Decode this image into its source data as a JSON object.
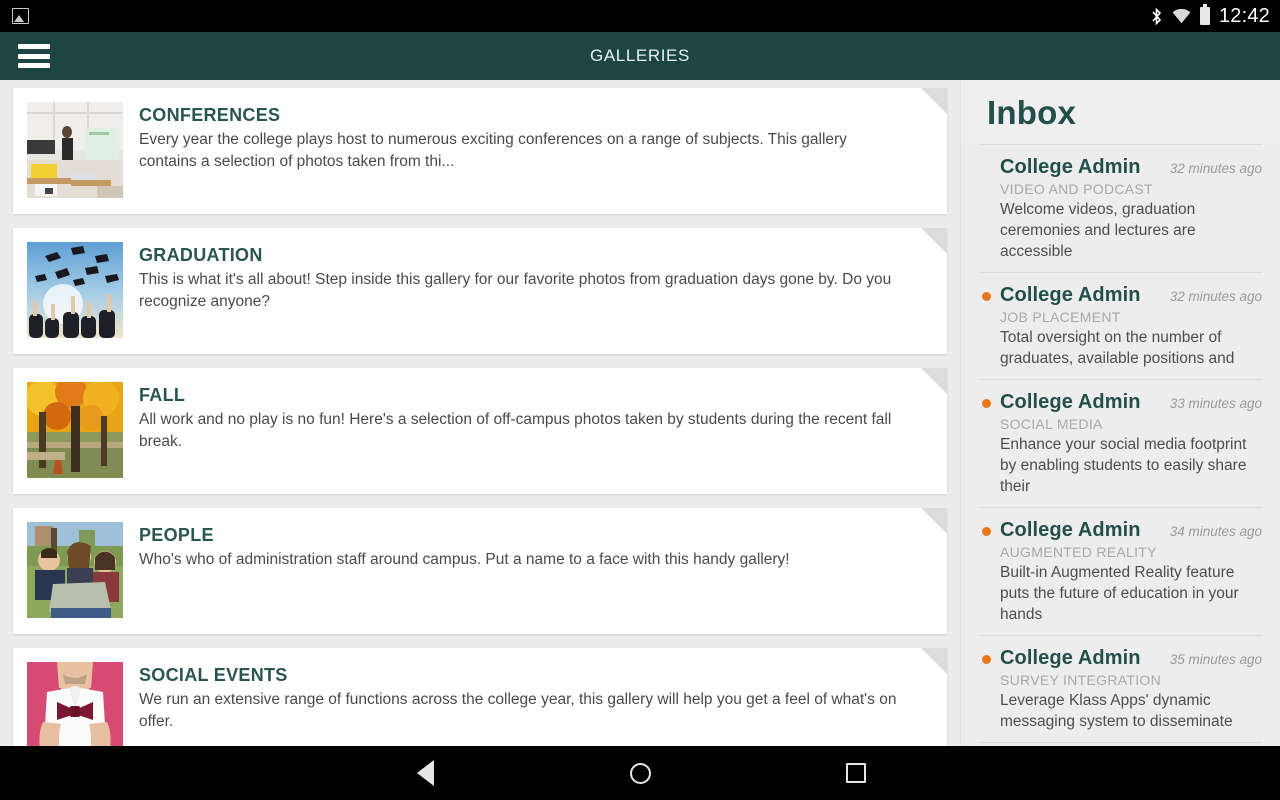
{
  "status_bar": {
    "notification_icon": "photo-icon",
    "icons": [
      "bluetooth-icon",
      "wifi-icon",
      "battery-icon"
    ],
    "time": "12:42"
  },
  "app_bar": {
    "menu_icon": "hamburger-menu-icon",
    "title": "GALLERIES"
  },
  "galleries": [
    {
      "title": "CONFERENCES",
      "description": "Every year the college plays host to numerous exciting conferences on a range of subjects.  This gallery contains a selection of photos taken from thi...",
      "thumb": "conference-lecture-hall-photo"
    },
    {
      "title": "GRADUATION",
      "description": "This is what it's all about!  Step inside this gallery for our favorite photos from graduation days gone by.  Do you recognize anyone?",
      "thumb": "graduation-caps-thrown-photo"
    },
    {
      "title": "FALL",
      "description": "All work and no play is no fun!  Here's a selection of off-campus photos taken by students during the recent fall break.",
      "thumb": "autumn-trees-park-photo"
    },
    {
      "title": "PEOPLE",
      "description": "Who's who of administration staff around campus.  Put a name to a face with this handy gallery!",
      "thumb": "students-with-laptop-photo"
    },
    {
      "title": "SOCIAL EVENTS",
      "description": "We run an extensive range of functions across the college year, this gallery will help you get a feel of what's on offer.",
      "thumb": "man-with-bowtie-photo"
    }
  ],
  "inbox": {
    "title": "Inbox",
    "unread_dot_color": "#e8761d",
    "items": [
      {
        "sender": "College Admin",
        "time": "32 minutes ago",
        "category": "VIDEO AND PODCAST",
        "preview": "Welcome videos, graduation ceremonies and lectures are accessible",
        "unread": false
      },
      {
        "sender": "College Admin",
        "time": "32 minutes ago",
        "category": "JOB PLACEMENT",
        "preview": "Total oversight on the number of graduates, available positions and",
        "unread": true
      },
      {
        "sender": "College Admin",
        "time": "33 minutes ago",
        "category": "SOCIAL MEDIA",
        "preview": "Enhance your social media footprint by enabling students to easily share their",
        "unread": true
      },
      {
        "sender": "College Admin",
        "time": "34 minutes ago",
        "category": "AUGMENTED REALITY",
        "preview": "Built-in Augmented Reality feature puts the future of education in your hands",
        "unread": true
      },
      {
        "sender": "College Admin",
        "time": "35 minutes ago",
        "category": "SURVEY INTEGRATION",
        "preview": "Leverage Klass Apps' dynamic messaging system to disseminate",
        "unread": true
      }
    ]
  },
  "nav_bar": {
    "back": "back-triangle-icon",
    "home": "home-circle-icon",
    "recents": "recents-square-icon"
  },
  "theme": {
    "app_bar_color": "#1d4642",
    "accent_color": "#234e49",
    "page_background": "#ececec"
  }
}
